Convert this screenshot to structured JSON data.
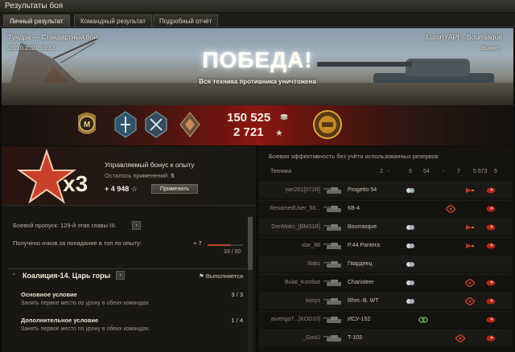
{
  "window": {
    "title": "Результаты боя"
  },
  "tabs": [
    {
      "label": "Личный результат",
      "active": true
    },
    {
      "label": "Командный результат",
      "active": false
    },
    {
      "label": "Подробный отчёт",
      "active": false
    }
  ],
  "banner": {
    "map_mode": "Тундра — Стандартный бой",
    "datetime": "28.10.2021 19:33",
    "player": "Luror[YAP] – Bourrasque",
    "exit_label": "Выжил",
    "result": "ПОБЕДА!",
    "subtitle": "Вся техника противника уничтожена"
  },
  "rewards": {
    "credits": "150 525",
    "xp": "2 721",
    "xp_icon": "★"
  },
  "bonus": {
    "multiplier": "x3",
    "title": "Управляемый бонус к опыту",
    "remaining_label": "Осталось применений:",
    "remaining_value": "5",
    "value": "+ 4 948",
    "star": "☆",
    "apply_label": "Применить"
  },
  "battle_pass": {
    "line": "Боевой пропуск: 129-й этап главы III.",
    "points_label": "Получено очков за попадание в топ по опыту:",
    "points_plus": "+ 7",
    "points_count": "33 / 50",
    "progress": 0.66
  },
  "mission": {
    "title": "Коалиция-14. Царь горы",
    "status": "Выполняется",
    "conditions": [
      {
        "title": "Основное условие",
        "desc": "Занять первое место по урону в обеих командах.",
        "count": "3 / 3"
      },
      {
        "title": "Дополнительное условие",
        "desc": "Занять первое место по урону в обеих командах.",
        "count": "1 / 4"
      }
    ]
  },
  "efficiency": {
    "title": "Боевая эффективность без учёта использованных резервов",
    "header": {
      "tech": "Техника",
      "c1": "2",
      "c2": "-",
      "c3": "5",
      "c4": "54",
      "c5": "-",
      "c6": "7",
      "c7": "5 573",
      "c8": "5"
    },
    "rows": [
      {
        "player": "yan201[071R]",
        "tank": "Progetto 54"
      },
      {
        "player": "RenamedUser_58...",
        "tank": "КВ-4"
      },
      {
        "player": "DonMaks_[BM31R]",
        "tank": "Bourrasque"
      },
      {
        "player": "star_88",
        "tank": "P.44 Pantera"
      },
      {
        "player": "Illaks",
        "tank": "Гвардеец"
      },
      {
        "player": "Bulat_Kombat",
        "tank": "Charioteer"
      },
      {
        "player": "kosys",
        "tank": "Rhm.-B. WT"
      },
      {
        "player": "aivengo7...[KOD10]",
        "tank": "ИСУ-152"
      },
      {
        "player": "_GosU",
        "tank": "T-103"
      }
    ]
  },
  "colors": {
    "accent_red": "#8d1610",
    "text_light": "#f2ecdd",
    "panel": "#181713"
  }
}
